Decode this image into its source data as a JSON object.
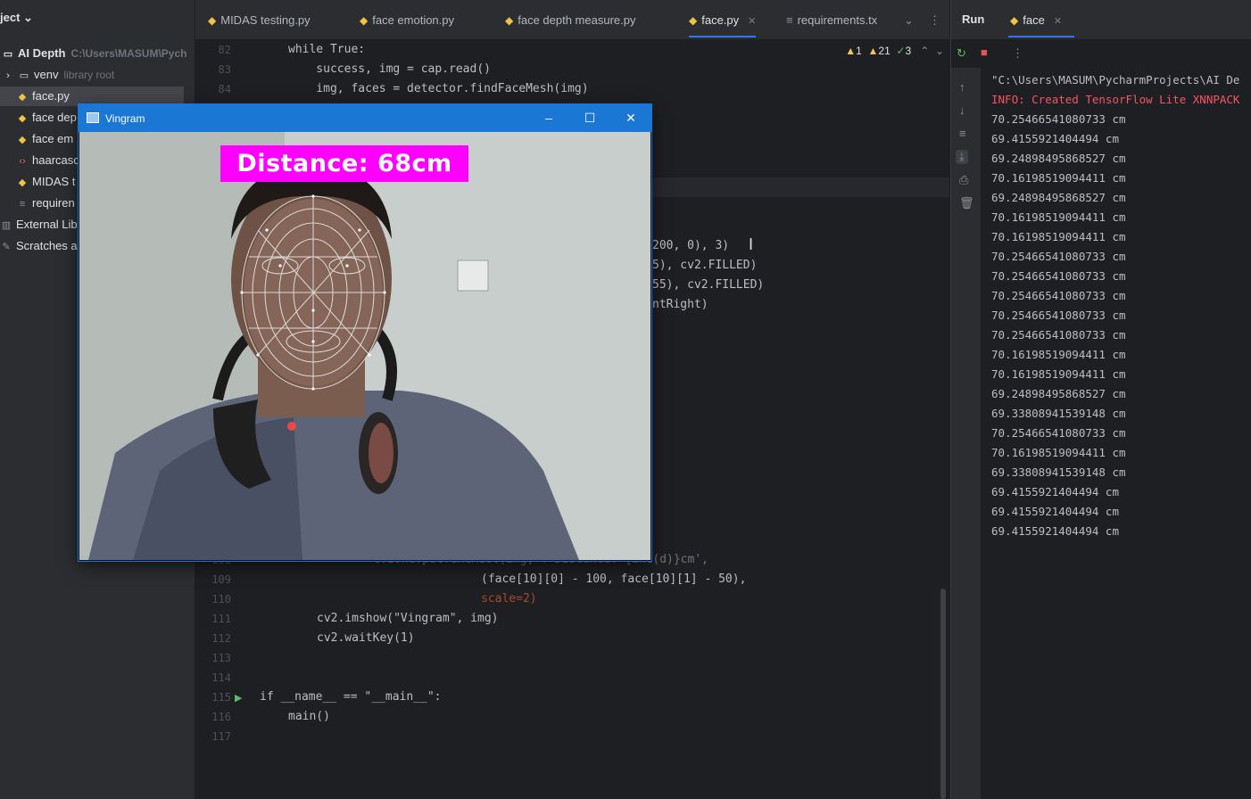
{
  "sidebar": {
    "header": "ject",
    "items": [
      {
        "label": "AI Depth",
        "hint": "C:\\Users\\MASUM\\Pych"
      },
      {
        "label": "venv",
        "hint": "library root"
      },
      {
        "label": "face.py",
        "hint": ""
      },
      {
        "label": "face dep",
        "hint": ""
      },
      {
        "label": "face em",
        "hint": ""
      },
      {
        "label": "haarcasc",
        "hint": ""
      },
      {
        "label": "MIDAS t",
        "hint": ""
      },
      {
        "label": "requiren",
        "hint": ""
      },
      {
        "label": "External Lib",
        "hint": ""
      },
      {
        "label": "Scratches a",
        "hint": ""
      }
    ]
  },
  "tabs": [
    {
      "label": "MIDAS testing.py"
    },
    {
      "label": "face emotion.py"
    },
    {
      "label": "face depth measure.py"
    },
    {
      "label": "face.py",
      "active": true
    },
    {
      "label": "requirements.tx"
    }
  ],
  "editor": {
    "inspections": {
      "warn1": "1",
      "warn2": "21",
      "ok": "3"
    },
    "lines": [
      {
        "n": "82",
        "code": "while True:"
      },
      {
        "n": "83",
        "code": "    success, img = cap.read()"
      },
      {
        "n": "84",
        "code": "    img, faces = detector.findFaceMesh(img)"
      },
      {
        "n": "",
        "code": "200, 0), 3)"
      },
      {
        "n": "",
        "code": "5), cv2.FILLED)"
      },
      {
        "n": "",
        "code": "55), cv2.FILLED)"
      },
      {
        "n": "",
        "code": "ntRight)"
      },
      {
        "n": "108",
        "code": "    cvzone.putTextRect(img, f'Distance: {int(d)}cm',"
      },
      {
        "n": "109",
        "code": "(face[10][0] - 100, face[10][1] - 50),"
      },
      {
        "n": "110",
        "code": "scale=2)"
      },
      {
        "n": "111",
        "code": "cv2.imshow(\"Vingram\", img)"
      },
      {
        "n": "112",
        "code": "cv2.waitKey(1)"
      },
      {
        "n": "113",
        "code": ""
      },
      {
        "n": "114",
        "code": ""
      },
      {
        "n": "115",
        "code": "if __name__ == \"__main__\":"
      },
      {
        "n": "116",
        "code": "main()"
      },
      {
        "n": "117",
        "code": ""
      }
    ]
  },
  "run": {
    "title": "Run",
    "tab": "face",
    "output_path": "\"C:\\Users\\MASUM\\PycharmProjects\\AI De",
    "output_info": "INFO: Created TensorFlow Lite XNNPACK",
    "output_values": [
      "70.25466541080733 cm",
      "69.4155921404494 cm",
      "69.24898495868527 cm",
      "70.16198519094411 cm",
      "69.24898495868527 cm",
      "70.16198519094411 cm",
      "70.16198519094411 cm",
      "70.25466541080733 cm",
      "70.25466541080733 cm",
      "70.25466541080733 cm",
      "70.25466541080733 cm",
      "70.25466541080733 cm",
      "70.16198519094411 cm",
      "70.16198519094411 cm",
      "69.24898495868527 cm",
      "69.33808941539148 cm",
      "70.25466541080733 cm",
      "70.16198519094411 cm",
      "69.33808941539148 cm",
      "69.4155921404494 cm",
      "69.4155921404494 cm",
      "69.4155921404494 cm"
    ]
  },
  "cv_window": {
    "title": "Vingram",
    "distance_label": "Distance: 68cm"
  }
}
